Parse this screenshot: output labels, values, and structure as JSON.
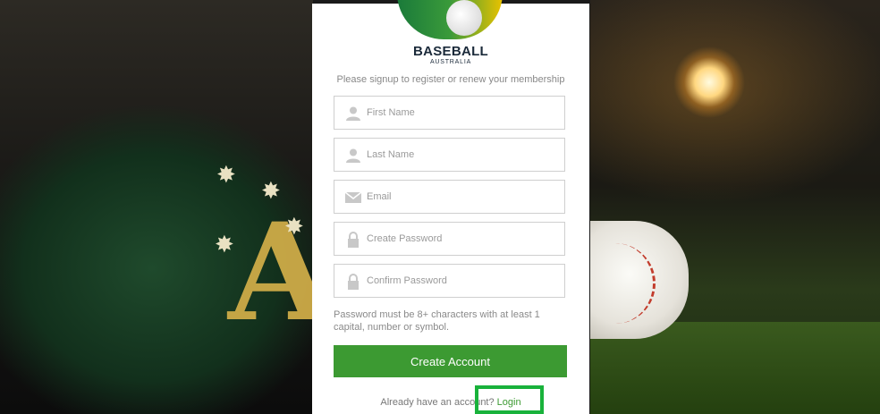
{
  "brand": {
    "name": "BASEBALL",
    "subtitle": "AUSTRALIA"
  },
  "intro_text": "Please signup to register or renew your membership",
  "fields": [
    {
      "placeholder": "First Name",
      "icon": "user-icon"
    },
    {
      "placeholder": "Last Name",
      "icon": "user-icon"
    },
    {
      "placeholder": "Email",
      "icon": "envelope-icon"
    },
    {
      "placeholder": "Create Password",
      "icon": "lock-icon"
    },
    {
      "placeholder": "Confirm Password",
      "icon": "lock-icon"
    }
  ],
  "password_hint": "Password must be 8+ characters with at least 1 capital, number or symbol.",
  "submit_label": "Create Account",
  "footer": {
    "text": "Already have an account?",
    "link": "Login"
  },
  "colors": {
    "accent": "#3c9a32",
    "highlight": "#19b23b"
  }
}
